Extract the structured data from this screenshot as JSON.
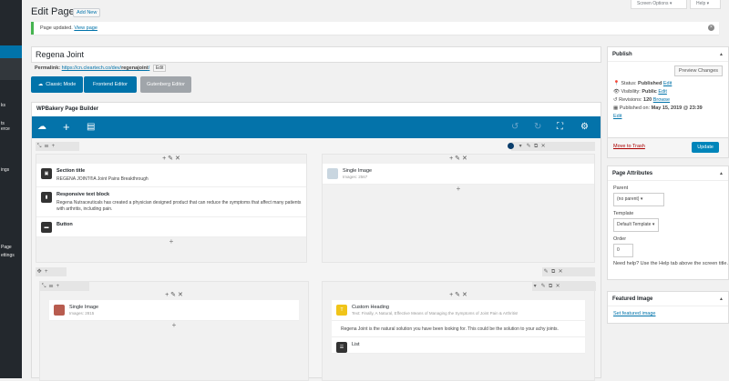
{
  "admin_menu": {
    "items": [
      "ks",
      "ts",
      "erce",
      "ings",
      "Page",
      "ettings"
    ]
  },
  "top": {
    "screen_options": "Screen Options ▾",
    "help": "Help ▾"
  },
  "header": {
    "title": "Edit Page",
    "add_new": "Add New"
  },
  "notice": {
    "text": "Page updated.",
    "link": "View page"
  },
  "post": {
    "title": "Regena Joint",
    "permalink_label": "Permalink:",
    "permalink_url_prefix": "https://cn.cleartech.co/dev/",
    "permalink_slug": "regenajoint",
    "permalink_suffix": "/",
    "edit_label": "Edit"
  },
  "editor_buttons": {
    "classic": "Classic Mode",
    "frontend": "Frontend Editor",
    "gutenberg": "Gutenberg Editor"
  },
  "wpbakery": {
    "title": "WPBakery Page Builder",
    "rows": [
      {
        "left": [
          {
            "name": "Section title",
            "text": "REGENA JOINT®A Joint Pains Breakthrough"
          },
          {
            "name": "Responsive text block",
            "text": "Regena Nutraceuticals has created a physician designed product that can reduce the symptoms that affect many patients with arthritis, including pain."
          },
          {
            "name": "Button",
            "text": ""
          }
        ],
        "right": [
          {
            "name": "Single Image",
            "sub": "Images: 2567"
          }
        ]
      },
      {
        "left": [
          {
            "name": "Single Image",
            "sub": "Images: 2815"
          }
        ],
        "right": [
          {
            "name": "Custom Heading",
            "sub": "Text: Finally, A Natural, Effective Means of Managing the Symptoms of Joint Pain & Arthritis!"
          },
          {
            "name": "",
            "text": "Regena Joint is the natural solution you have been looking for. This could be the solution to your achy joints."
          },
          {
            "name": "List",
            "text": ""
          }
        ]
      }
    ]
  },
  "publish": {
    "title": "Publish",
    "preview": "Preview Changes",
    "status_label": "Status:",
    "status_value": "Published",
    "visibility_label": "Visibility:",
    "visibility_value": "Public",
    "revisions_label": "Revisions:",
    "revisions_value": "120",
    "browse": "Browse",
    "published_on_label": "Published on:",
    "published_on_value": "May 15, 2019 @ 23:39",
    "edit": "Edit",
    "trash": "Move to Trash",
    "update": "Update"
  },
  "page_attributes": {
    "title": "Page Attributes",
    "parent_label": "Parent",
    "parent_value": "(no parent)",
    "template_label": "Template",
    "template_value": "Default Template",
    "order_label": "Order",
    "order_value": "0",
    "help": "Need help? Use the Help tab above the screen title."
  },
  "featured_image": {
    "title": "Featured Image",
    "link": "Set featured image"
  },
  "colors": {
    "accent": "#0073aa",
    "toolbar": "#0473aa",
    "admin_bar": "#23282d"
  }
}
